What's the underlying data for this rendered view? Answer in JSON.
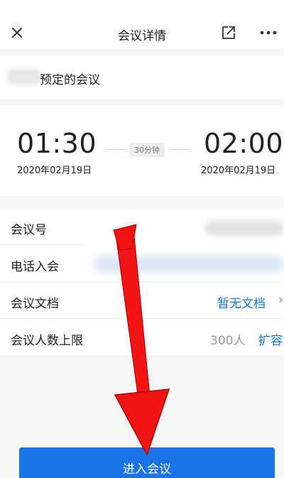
{
  "header": {
    "title": "会议详情",
    "close_icon": "close-icon",
    "share_icon": "external-link-icon",
    "more_icon": "more-icon"
  },
  "organizer": {
    "suffix": "预定的会议"
  },
  "meeting_time": {
    "start_time": "01:30",
    "start_date": "2020年02月19日",
    "duration": "30分钟",
    "end_time": "02:00",
    "end_date": "2020年02月19日"
  },
  "details": {
    "meeting_id_label": "会议号",
    "phone_label": "电话入会",
    "docs_label": "会议文档",
    "docs_value": "暂无文档",
    "limit_label": "会议人数上限",
    "limit_value": "300人",
    "limit_action": "扩容"
  },
  "footer": {
    "join_label": "进入会议"
  },
  "colors": {
    "accent": "#1a73e8",
    "link": "#1677e6",
    "annotation_arrow": "#f01414"
  }
}
